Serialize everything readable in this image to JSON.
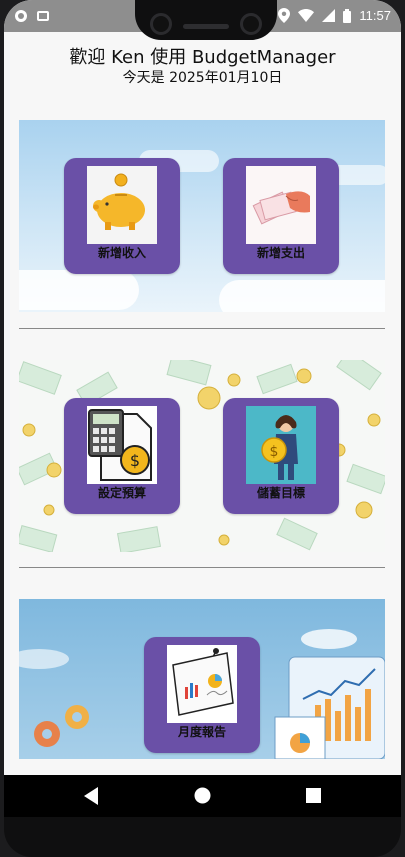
{
  "status_bar": {
    "time": "11:57",
    "left_icons": [
      "notification-icon",
      "app-icon"
    ],
    "right_icons": [
      "location-icon",
      "wifi-icon",
      "signal-icon",
      "battery-icon"
    ]
  },
  "header": {
    "welcome": "歡迎 Ken 使用 BudgetManager",
    "today": "今天是 2025年01月10日"
  },
  "tiles": {
    "add_income": {
      "label": "新增收入",
      "icon": "piggy-bank-icon"
    },
    "add_expense": {
      "label": "新增支出",
      "icon": "money-hand-icon"
    },
    "set_budget": {
      "label": "設定預算",
      "icon": "calculator-budget-icon"
    },
    "savings_goal": {
      "label": "儲蓄目標",
      "icon": "savings-woman-icon"
    },
    "monthly_report": {
      "label": "月度報告",
      "icon": "report-chart-icon"
    }
  },
  "navbar": {
    "buttons": [
      "back-icon",
      "home-icon",
      "recents-icon"
    ]
  },
  "colors": {
    "tile": "#6a50a7",
    "statusbar": "#8e8e8e"
  }
}
